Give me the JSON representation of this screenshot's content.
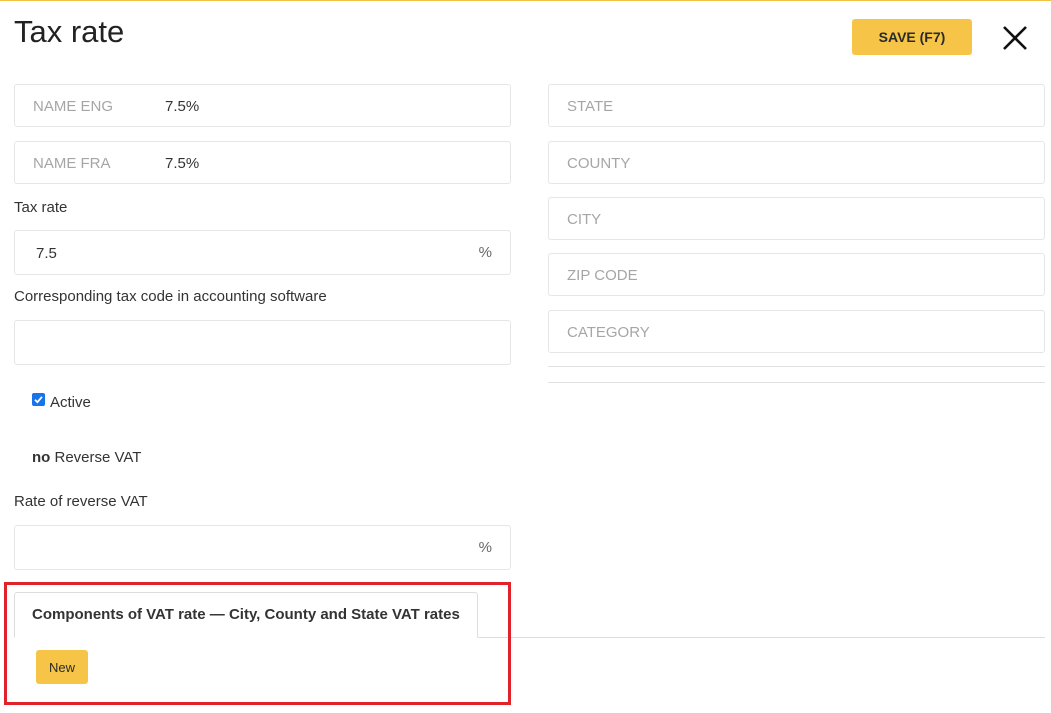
{
  "header": {
    "title": "Tax rate",
    "save_label": "SAVE (F7)"
  },
  "form": {
    "name_eng": {
      "label": "NAME ENG",
      "value": "7.5%"
    },
    "name_fra": {
      "label": "NAME FRA",
      "value": "7.5%"
    },
    "tax_rate": {
      "label": "Tax rate",
      "value": "7.5",
      "unit": "%"
    },
    "accounting_code": {
      "label": "Corresponding tax code in accounting software",
      "value": ""
    },
    "active": {
      "label": "Active",
      "checked": true
    },
    "reverse_vat": {
      "prefix": "no",
      "label": "Reverse VAT"
    },
    "reverse_rate": {
      "label": "Rate of reverse VAT",
      "value": "",
      "unit": "%"
    }
  },
  "location": {
    "state": "STATE",
    "county": "COUNTY",
    "city": "CITY",
    "zip": "ZIP CODE",
    "category": "CATEGORY"
  },
  "components": {
    "tab_label": "Components of VAT rate — City, County and State VAT rates",
    "new_label": "New"
  },
  "colors": {
    "accent": "#f6c547",
    "highlight": "#e0232a",
    "checkbox": "#1a73e8"
  }
}
